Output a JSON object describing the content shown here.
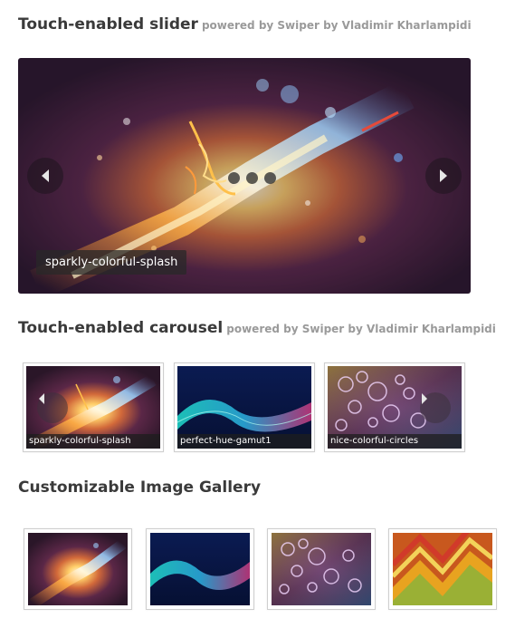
{
  "slider_section": {
    "title": "Touch-enabled slider",
    "powered": "powered by Swiper by Vladimir Kharlampidi",
    "caption": "sparkly-colorful-splash"
  },
  "carousel_section": {
    "title": "Touch-enabled carousel",
    "powered": "powered by Swiper by Vladimir Kharlampidi",
    "items": [
      {
        "caption": "sparkly-colorful-splash"
      },
      {
        "caption": "perfect-hue-gamut1"
      },
      {
        "caption": "nice-colorful-circles"
      }
    ]
  },
  "gallery_section": {
    "title": "Customizable Image Gallery",
    "thumbs": [
      "sparkly-splash",
      "hue-gamut",
      "colorful-circles",
      "orange-zigzag"
    ]
  },
  "icons": {
    "prev": "chevron-left-icon",
    "next": "chevron-right-icon"
  }
}
